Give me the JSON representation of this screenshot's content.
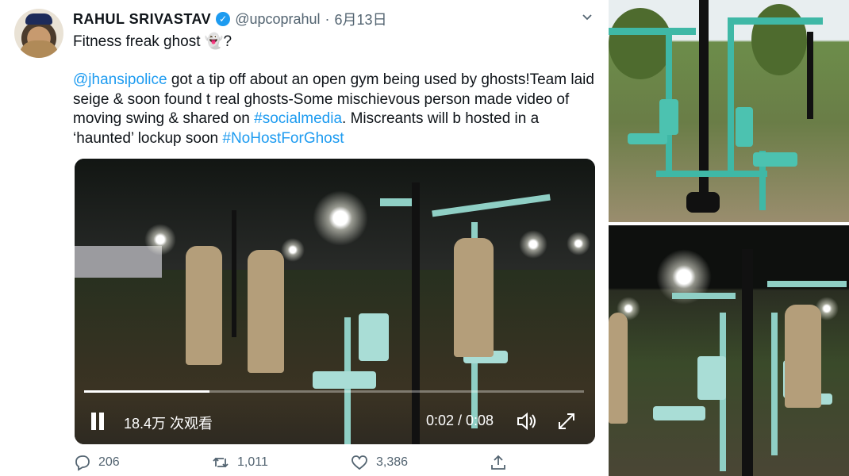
{
  "tweet": {
    "author_name": "RAHUL SRIVASTAV",
    "handle": "@upcoprahul",
    "separator": "·",
    "date": "6月13日",
    "line1": "Fitness freak ghost 👻?",
    "body": {
      "mention": "@jhansipolice",
      "text1": " got a tip off about an open gym being used by ghosts!Team laid seige & soon found t real ghosts-Some mischievous person made video of moving swing & shared on ",
      "hashtag1": "#socialmedia",
      "text2": ". Miscreants will b hosted in a ‘haunted’ lockup soon ",
      "hashtag2": "#NoHostForGhost"
    }
  },
  "video": {
    "views": "18.4万 次观看",
    "time": "0:02 / 0:08",
    "progress": 0.25
  },
  "actions": {
    "replies": "206",
    "retweets": "1,011",
    "likes": "3,386"
  },
  "icons": {
    "verified": "verified-badge-icon",
    "caret": "chevron-down-icon",
    "pause": "pause-icon",
    "volume": "volume-icon",
    "fullscreen": "fullscreen-icon",
    "reply": "reply-icon",
    "retweet": "retweet-icon",
    "like": "heart-icon",
    "share": "share-icon"
  },
  "colors": {
    "link": "#1d9bf0",
    "muted": "#536471",
    "text": "#0f1419"
  }
}
